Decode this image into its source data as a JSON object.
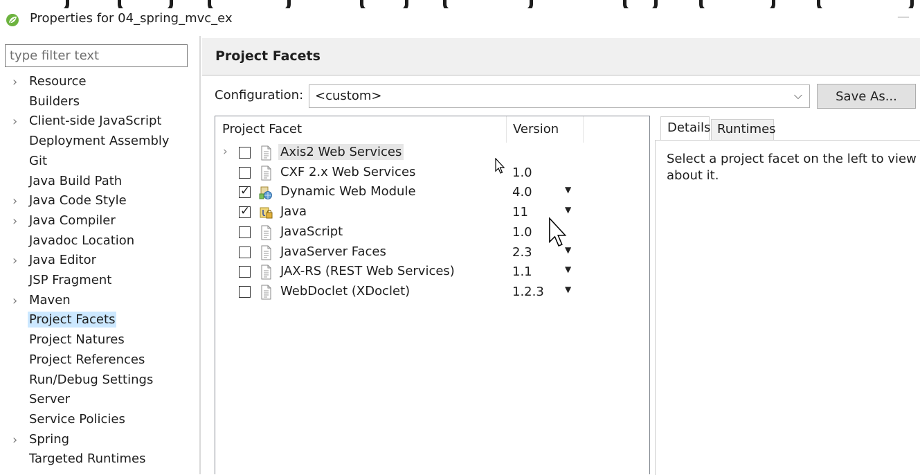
{
  "window": {
    "title": "Properties for 04_spring_mvc_ex"
  },
  "filter": {
    "placeholder": "type filter text"
  },
  "nav": {
    "items": [
      {
        "label": "Resource",
        "expandable": true
      },
      {
        "label": "Builders",
        "expandable": false
      },
      {
        "label": "Client-side JavaScript",
        "expandable": true
      },
      {
        "label": "Deployment Assembly",
        "expandable": false
      },
      {
        "label": "Git",
        "expandable": false
      },
      {
        "label": "Java Build Path",
        "expandable": false
      },
      {
        "label": "Java Code Style",
        "expandable": true
      },
      {
        "label": "Java Compiler",
        "expandable": true
      },
      {
        "label": "Javadoc Location",
        "expandable": false
      },
      {
        "label": "Java Editor",
        "expandable": true
      },
      {
        "label": "JSP Fragment",
        "expandable": false
      },
      {
        "label": "Maven",
        "expandable": true
      },
      {
        "label": "Project Facets",
        "expandable": false,
        "selected": true
      },
      {
        "label": "Project Natures",
        "expandable": false
      },
      {
        "label": "Project References",
        "expandable": false
      },
      {
        "label": "Run/Debug Settings",
        "expandable": false
      },
      {
        "label": "Server",
        "expandable": false
      },
      {
        "label": "Service Policies",
        "expandable": false
      },
      {
        "label": "Spring",
        "expandable": true
      },
      {
        "label": "Targeted Runtimes",
        "expandable": false
      }
    ]
  },
  "page": {
    "title": "Project Facets",
    "configuration_label": "Configuration:",
    "configuration_value": "<custom>",
    "save_as_label": "Save As..."
  },
  "facets": {
    "columns": {
      "facet": "Project Facet",
      "version": "Version"
    },
    "rows": [
      {
        "name": "Axis2 Web Services",
        "version": "",
        "checked": false,
        "expandable": true,
        "highlighted": true,
        "icon": "document-icon",
        "dropdown": false
      },
      {
        "name": "CXF 2.x Web Services",
        "version": "1.0",
        "checked": false,
        "expandable": false,
        "highlighted": false,
        "icon": "document-icon",
        "dropdown": false
      },
      {
        "name": "Dynamic Web Module",
        "version": "4.0",
        "checked": true,
        "expandable": false,
        "highlighted": false,
        "icon": "web-module-icon",
        "dropdown": true
      },
      {
        "name": "Java",
        "version": "11",
        "checked": true,
        "expandable": false,
        "highlighted": false,
        "icon": "java-locked-icon",
        "dropdown": true
      },
      {
        "name": "JavaScript",
        "version": "1.0",
        "checked": false,
        "expandable": false,
        "highlighted": false,
        "icon": "document-icon",
        "dropdown": false
      },
      {
        "name": "JavaServer Faces",
        "version": "2.3",
        "checked": false,
        "expandable": false,
        "highlighted": false,
        "icon": "document-icon",
        "dropdown": true
      },
      {
        "name": "JAX-RS (REST Web Services)",
        "version": "1.1",
        "checked": false,
        "expandable": false,
        "highlighted": false,
        "icon": "document-icon",
        "dropdown": true
      },
      {
        "name": "WebDoclet (XDoclet)",
        "version": "1.2.3",
        "checked": false,
        "expandable": false,
        "highlighted": false,
        "icon": "document-icon",
        "dropdown": true
      }
    ]
  },
  "details": {
    "tabs": [
      "Details",
      "Runtimes"
    ],
    "line1": "Select a project facet on the left to view in",
    "line2": "about it."
  },
  "colors": {
    "selection": "#cce8ff",
    "header_bg": "#f0f0f0",
    "button_bg": "#e1e1e1",
    "spring_green": "#6db33f"
  }
}
